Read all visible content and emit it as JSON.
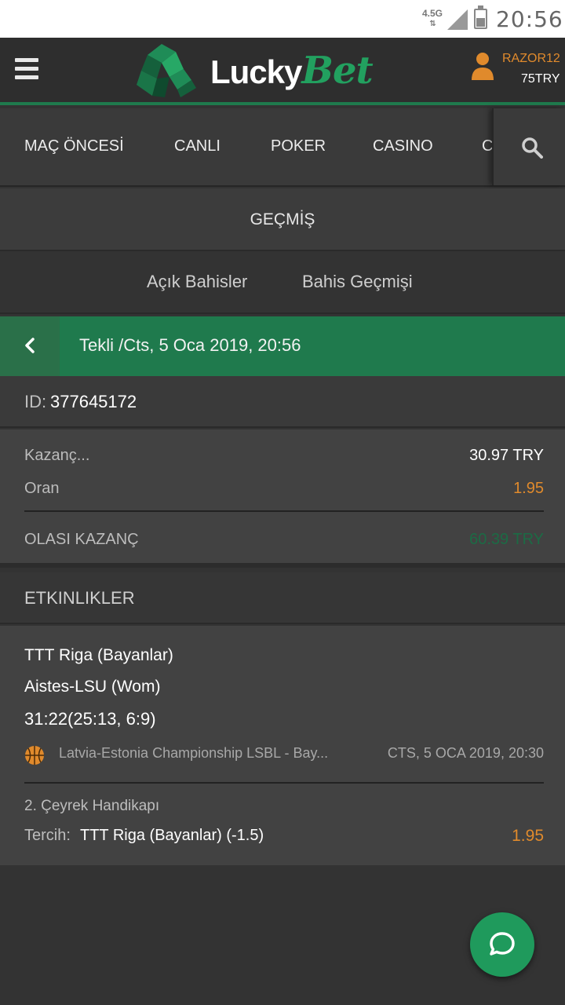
{
  "status_bar": {
    "network": "4.5G",
    "time": "20:56"
  },
  "header": {
    "logo_primary": "Lucky",
    "logo_accent": "Bet",
    "username": "RAZOR12",
    "balance": "75TRY"
  },
  "nav": {
    "tabs": [
      {
        "label": "MAÇ ÖNCESİ"
      },
      {
        "label": "CANLI"
      },
      {
        "label": "POKER"
      },
      {
        "label": "CASINO"
      },
      {
        "label": "C"
      }
    ]
  },
  "section_title": "GEÇMİŞ",
  "sub_tabs": [
    {
      "label": "Açık Bahisler"
    },
    {
      "label": "Bahis Geçmişi"
    }
  ],
  "bet": {
    "title": "Tekli /Cts, 5 Oca 2019, 20:56",
    "id_label": "ID:",
    "id_value": "377645172",
    "stake_label": "Kazanç...",
    "stake_value": "30.97 TRY",
    "odds_label": "Oran",
    "odds_value": "1.95",
    "potential_label": "OLASI KAZANÇ",
    "potential_value": "60.39 TRY"
  },
  "events": {
    "heading": "ETKINLIKLER",
    "items": [
      {
        "home_team": "TTT Riga (Bayanlar)",
        "away_team": "Aistes-LSU (Wom)",
        "score": "31:22(25:13, 6:9)",
        "league": "Latvia-Estonia Championship LSBL - Bay...",
        "date": "CTS, 5 OCA 2019, 20:30",
        "market": "2. Çeyrek Handikapı",
        "choice_label": "Tercih:",
        "choice_value": "TTT Riga (Bayanlar) (-1.5)",
        "choice_odds": "1.95"
      }
    ]
  },
  "colors": {
    "brand_green": "#1f7a4d",
    "accent_orange": "#e08a2c",
    "potential_green": "#1c6b45",
    "fab_green": "#1f9a5c"
  }
}
